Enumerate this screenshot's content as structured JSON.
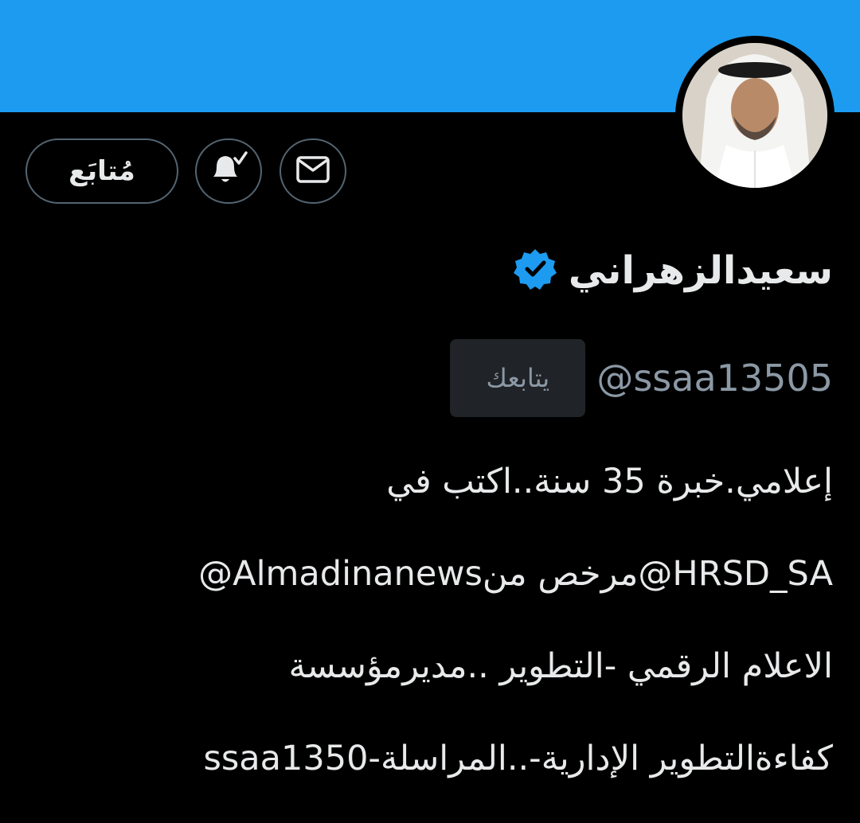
{
  "header": {
    "banner_color": "#1d9bf0"
  },
  "profile": {
    "display_name": "سعيدالزهراني",
    "verified": true,
    "verified_color": "#1d9bf0",
    "handle": "@ssaa13505",
    "follows_you_badge": "يتابعك",
    "avatar_icon": "profile-photo"
  },
  "actions": {
    "follow_label": "مُتابَع",
    "notifications_icon": "bell-check-icon",
    "message_icon": "envelope-icon"
  },
  "bio": {
    "lines": [
      "إعلامي.خبرة 35 سنة..اكتب في",
      "@Almadinanewsمرخص من@HRSD_SA",
      "الاعلام الرقمي -التطوير ..مديرمؤسسة",
      "كفاءةالتطوير الإدارية-..المراسلة-ssaa1350"
    ]
  }
}
